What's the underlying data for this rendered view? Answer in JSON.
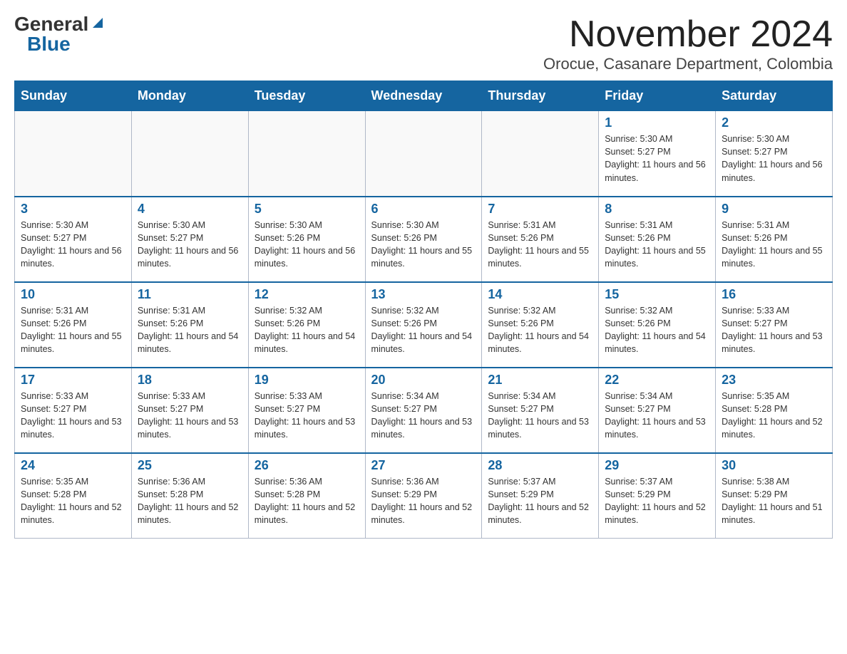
{
  "logo": {
    "general": "General",
    "blue": "Blue",
    "triangle": "▲"
  },
  "header": {
    "month_title": "November 2024",
    "location": "Orocue, Casanare Department, Colombia"
  },
  "days_of_week": [
    "Sunday",
    "Monday",
    "Tuesday",
    "Wednesday",
    "Thursday",
    "Friday",
    "Saturday"
  ],
  "weeks": [
    [
      {
        "day": "",
        "info": ""
      },
      {
        "day": "",
        "info": ""
      },
      {
        "day": "",
        "info": ""
      },
      {
        "day": "",
        "info": ""
      },
      {
        "day": "",
        "info": ""
      },
      {
        "day": "1",
        "info": "Sunrise: 5:30 AM\nSunset: 5:27 PM\nDaylight: 11 hours and 56 minutes."
      },
      {
        "day": "2",
        "info": "Sunrise: 5:30 AM\nSunset: 5:27 PM\nDaylight: 11 hours and 56 minutes."
      }
    ],
    [
      {
        "day": "3",
        "info": "Sunrise: 5:30 AM\nSunset: 5:27 PM\nDaylight: 11 hours and 56 minutes."
      },
      {
        "day": "4",
        "info": "Sunrise: 5:30 AM\nSunset: 5:27 PM\nDaylight: 11 hours and 56 minutes."
      },
      {
        "day": "5",
        "info": "Sunrise: 5:30 AM\nSunset: 5:26 PM\nDaylight: 11 hours and 56 minutes."
      },
      {
        "day": "6",
        "info": "Sunrise: 5:30 AM\nSunset: 5:26 PM\nDaylight: 11 hours and 55 minutes."
      },
      {
        "day": "7",
        "info": "Sunrise: 5:31 AM\nSunset: 5:26 PM\nDaylight: 11 hours and 55 minutes."
      },
      {
        "day": "8",
        "info": "Sunrise: 5:31 AM\nSunset: 5:26 PM\nDaylight: 11 hours and 55 minutes."
      },
      {
        "day": "9",
        "info": "Sunrise: 5:31 AM\nSunset: 5:26 PM\nDaylight: 11 hours and 55 minutes."
      }
    ],
    [
      {
        "day": "10",
        "info": "Sunrise: 5:31 AM\nSunset: 5:26 PM\nDaylight: 11 hours and 55 minutes."
      },
      {
        "day": "11",
        "info": "Sunrise: 5:31 AM\nSunset: 5:26 PM\nDaylight: 11 hours and 54 minutes."
      },
      {
        "day": "12",
        "info": "Sunrise: 5:32 AM\nSunset: 5:26 PM\nDaylight: 11 hours and 54 minutes."
      },
      {
        "day": "13",
        "info": "Sunrise: 5:32 AM\nSunset: 5:26 PM\nDaylight: 11 hours and 54 minutes."
      },
      {
        "day": "14",
        "info": "Sunrise: 5:32 AM\nSunset: 5:26 PM\nDaylight: 11 hours and 54 minutes."
      },
      {
        "day": "15",
        "info": "Sunrise: 5:32 AM\nSunset: 5:26 PM\nDaylight: 11 hours and 54 minutes."
      },
      {
        "day": "16",
        "info": "Sunrise: 5:33 AM\nSunset: 5:27 PM\nDaylight: 11 hours and 53 minutes."
      }
    ],
    [
      {
        "day": "17",
        "info": "Sunrise: 5:33 AM\nSunset: 5:27 PM\nDaylight: 11 hours and 53 minutes."
      },
      {
        "day": "18",
        "info": "Sunrise: 5:33 AM\nSunset: 5:27 PM\nDaylight: 11 hours and 53 minutes."
      },
      {
        "day": "19",
        "info": "Sunrise: 5:33 AM\nSunset: 5:27 PM\nDaylight: 11 hours and 53 minutes."
      },
      {
        "day": "20",
        "info": "Sunrise: 5:34 AM\nSunset: 5:27 PM\nDaylight: 11 hours and 53 minutes."
      },
      {
        "day": "21",
        "info": "Sunrise: 5:34 AM\nSunset: 5:27 PM\nDaylight: 11 hours and 53 minutes."
      },
      {
        "day": "22",
        "info": "Sunrise: 5:34 AM\nSunset: 5:27 PM\nDaylight: 11 hours and 53 minutes."
      },
      {
        "day": "23",
        "info": "Sunrise: 5:35 AM\nSunset: 5:28 PM\nDaylight: 11 hours and 52 minutes."
      }
    ],
    [
      {
        "day": "24",
        "info": "Sunrise: 5:35 AM\nSunset: 5:28 PM\nDaylight: 11 hours and 52 minutes."
      },
      {
        "day": "25",
        "info": "Sunrise: 5:36 AM\nSunset: 5:28 PM\nDaylight: 11 hours and 52 minutes."
      },
      {
        "day": "26",
        "info": "Sunrise: 5:36 AM\nSunset: 5:28 PM\nDaylight: 11 hours and 52 minutes."
      },
      {
        "day": "27",
        "info": "Sunrise: 5:36 AM\nSunset: 5:29 PM\nDaylight: 11 hours and 52 minutes."
      },
      {
        "day": "28",
        "info": "Sunrise: 5:37 AM\nSunset: 5:29 PM\nDaylight: 11 hours and 52 minutes."
      },
      {
        "day": "29",
        "info": "Sunrise: 5:37 AM\nSunset: 5:29 PM\nDaylight: 11 hours and 52 minutes."
      },
      {
        "day": "30",
        "info": "Sunrise: 5:38 AM\nSunset: 5:29 PM\nDaylight: 11 hours and 51 minutes."
      }
    ]
  ]
}
